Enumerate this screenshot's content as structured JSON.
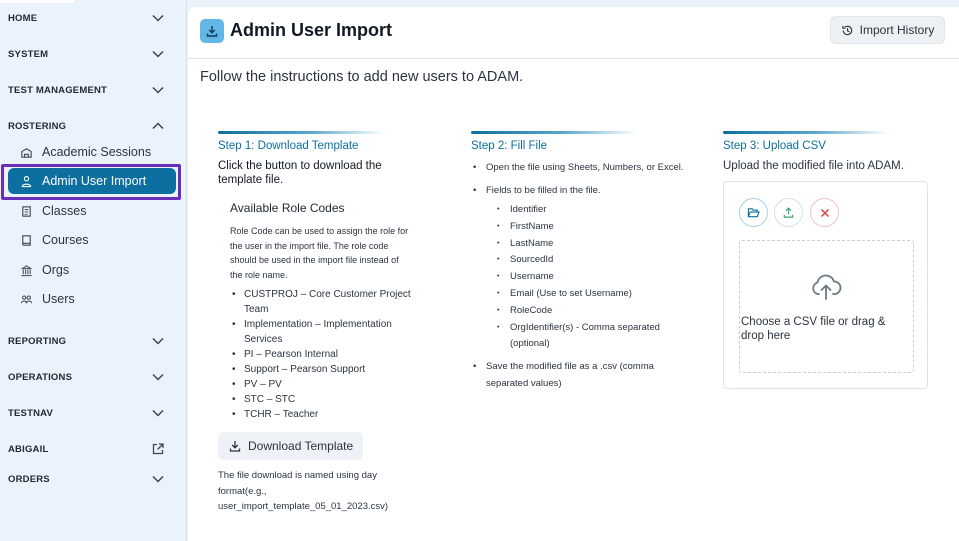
{
  "sidebar": {
    "sections": {
      "home": "HOME",
      "system": "SYSTEM",
      "test_management": "TEST MANAGEMENT",
      "rostering": "ROSTERING",
      "reporting": "REPORTING",
      "operations": "OPERATIONS",
      "testnav": "TESTNAV",
      "abigail": "ABIGAIL",
      "orders": "ORDERS"
    },
    "rostering_items": [
      {
        "label": "Academic Sessions",
        "icon": "school-icon"
      },
      {
        "label": "Admin User Import",
        "icon": "user-import-icon",
        "active": true
      },
      {
        "label": "Classes",
        "icon": "classes-icon"
      },
      {
        "label": "Courses",
        "icon": "book-icon"
      },
      {
        "label": "Orgs",
        "icon": "building-icon"
      },
      {
        "label": "Users",
        "icon": "users-icon"
      }
    ]
  },
  "header": {
    "title": "Admin User Import",
    "import_history_label": "Import History"
  },
  "intro": "Follow the instructions to add new users to ADAM.",
  "step1": {
    "title": "Step 1: Download Template",
    "lead": "Click the button to download the template file.",
    "roles_heading": "Available Role Codes",
    "roles_description": "Role Code can be used to assign the role for the user in the import file. The role code should be used in the import file instead of the role name.",
    "roles": [
      "CUSTPROJ – Core Customer Project Team",
      "Implementation – Implementation Services",
      "PI – Pearson Internal",
      "Support – Pearson Support",
      "PV – PV",
      "STC – STC",
      "TCHR – Teacher"
    ],
    "download_label": "Download Template",
    "download_note": "The file download is named using day format(e.g., user_import_template_05_01_2023.csv)"
  },
  "step2": {
    "title": "Step 2: Fill File",
    "open_file": "Open the file using Sheets, Numbers, or Excel.",
    "fields_intro": "Fields to be filled in the file.",
    "fields": [
      "Identifier",
      "FirstName",
      "LastName",
      "SourcedId",
      "Username",
      "Email (Use to set Username)",
      "RoleCode",
      "OrgIdentifier(s) - Comma separated (optional)"
    ],
    "save_note": "Save the modified file as a .csv (comma separated values)"
  },
  "step3": {
    "title": "Step 3: Upload CSV",
    "lead": "Upload the modified file into ADAM.",
    "drop_text": "Choose a CSV file or drag & drop here"
  },
  "colors": {
    "accent": "#0d6f9f",
    "focus_outline": "#6a2fb8",
    "sidebar_bg": "#eaf3fb",
    "danger": "#d64545",
    "success": "#3aa96b"
  }
}
